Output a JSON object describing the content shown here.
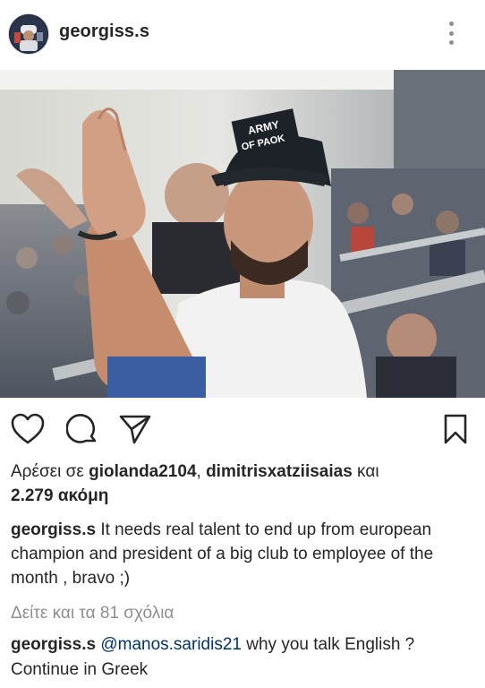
{
  "header": {
    "username": "georgiss.s",
    "avatar_icon": "profile-avatar",
    "more_icon": "more-options-icon"
  },
  "post": {
    "photo_text": {
      "cap_line1": "ARMY",
      "cap_line2": "OF PAOK"
    }
  },
  "actions": {
    "like_icon": "heart-icon",
    "comment_icon": "comment-bubble-icon",
    "share_icon": "paper-plane-icon",
    "save_icon": "bookmark-icon"
  },
  "likes": {
    "prefix": "Αρέσει σε ",
    "user1": "giolanda2104",
    "separator": ", ",
    "user2": "dimitrisxatziisaias",
    "conjunction": " και",
    "count_text": "2.279 ακόμη"
  },
  "caption": {
    "username": "georgiss.s",
    "text": " It needs real talent to end up from european champion and president of a big club to employee of the month , bravo ;)"
  },
  "view_comments": "Δείτε και τα 81 σχόλια",
  "comment": {
    "username": "georgiss.s",
    "mention": "@manos.saridis21",
    "text": " why you talk English ? Continue in Greek"
  },
  "colors": {
    "text": "#262626",
    "secondary": "#8e8e8e",
    "mention": "#003569"
  }
}
